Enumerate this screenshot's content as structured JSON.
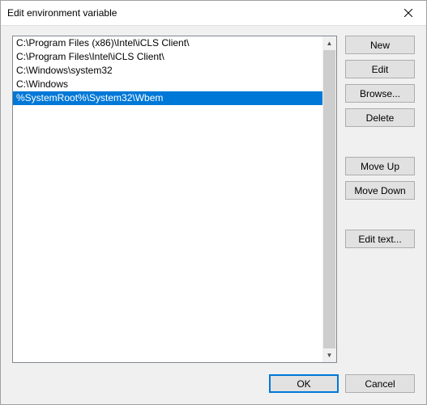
{
  "window": {
    "title": "Edit environment variable"
  },
  "list": {
    "items": [
      "C:\\Program Files (x86)\\Intel\\iCLS Client\\",
      "C:\\Program Files\\Intel\\iCLS Client\\",
      "C:\\Windows\\system32",
      "C:\\Windows",
      "%SystemRoot%\\System32\\Wbem"
    ],
    "selected_index": 4
  },
  "buttons": {
    "new": "New",
    "edit": "Edit",
    "browse": "Browse...",
    "delete": "Delete",
    "move_up": "Move Up",
    "move_down": "Move Down",
    "edit_text": "Edit text...",
    "ok": "OK",
    "cancel": "Cancel"
  }
}
